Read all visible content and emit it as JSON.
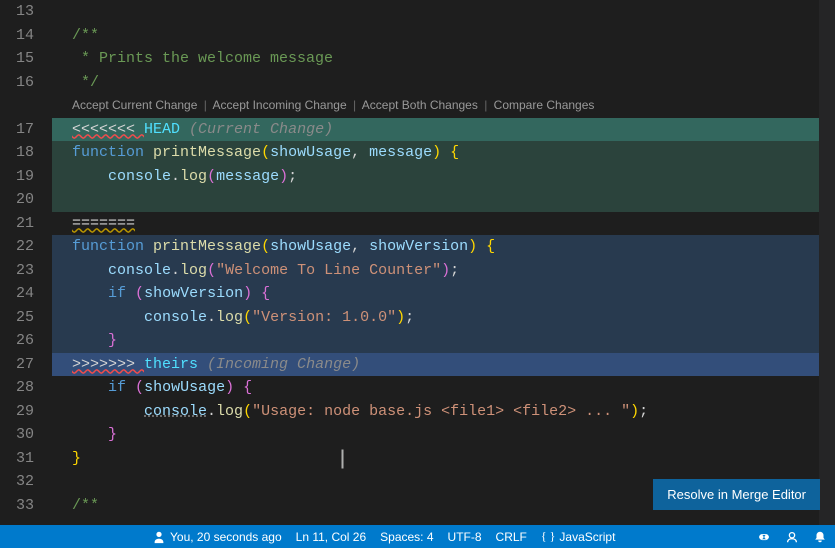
{
  "lines": {
    "start": 13,
    "doc1": "/**",
    "doc2": " * Prints the welcome message",
    "doc3": " */",
    "head_marker": "<<<<<<< ",
    "head_label": "HEAD",
    "head_annot": "(Current Change)",
    "mid_marker": "=======",
    "tail_marker": ">>>>>>> ",
    "tail_label": "theirs",
    "tail_annot": "(Incoming Change)",
    "fn_kw": "function",
    "fn_name": "printMessage",
    "p_showUsage": "showUsage",
    "p_message": "message",
    "p_showVersion": "showVersion",
    "console": "console",
    "log": "log",
    "if_kw": "if",
    "str_welcome": "\"Welcome To Line Counter\"",
    "str_version": "\"Version: 1.0.0\"",
    "str_usage": "\"Usage: node base.js <file1> <file2> ... \"",
    "doc4": "/**"
  },
  "codelens": {
    "accept_current": "Accept Current Change",
    "accept_incoming": "Accept Incoming Change",
    "accept_both": "Accept Both Changes",
    "compare": "Compare Changes"
  },
  "merge_button": "Resolve in Merge Editor",
  "status": {
    "blame": "You, 20 seconds ago",
    "pos": "Ln 11, Col 26",
    "spaces": "Spaces: 4",
    "encoding": "UTF-8",
    "eol": "CRLF",
    "lang": "JavaScript"
  }
}
